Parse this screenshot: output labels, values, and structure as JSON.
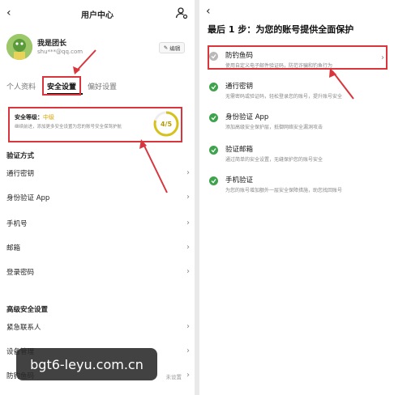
{
  "left": {
    "header": {
      "title": "用户中心"
    },
    "profile": {
      "name": "我是团长",
      "email": "shu***@qq.com",
      "edit_label": "编辑"
    },
    "tabs": [
      {
        "label": "个人资料"
      },
      {
        "label": "安全设置"
      },
      {
        "label": "偏好设置"
      }
    ],
    "security_card": {
      "title": "安全等级：",
      "level": "中级",
      "desc": "继续前进，添加更多安全设置为您的账号安全保驾护航",
      "score": "4/5"
    },
    "section_verify": "验证方式",
    "verify_items": [
      {
        "label": "通行密钥"
      },
      {
        "label": "身份验证 App"
      },
      {
        "label": "手机号"
      },
      {
        "label": "邮箱"
      },
      {
        "label": "登录密码"
      }
    ],
    "section_advanced": "高级安全设置",
    "advanced_items": [
      {
        "label": "紧急联系人",
        "extra": ""
      },
      {
        "label": "设备管理",
        "extra": ""
      },
      {
        "label": "防钓鱼码",
        "extra": "未设置"
      }
    ]
  },
  "watermark": "bgt6-leyu.com.cn",
  "right": {
    "title": "最后 1 步：为您的账号提供全面保护",
    "options": [
      {
        "title": "防钓鱼码",
        "desc": "使用自定义电子邮件验证码，防范诈骗和钓鱼行为",
        "done": false
      },
      {
        "title": "通行密钥",
        "desc": "无需密码或验证码，轻松登录您的账号，提升账号安全",
        "done": true
      },
      {
        "title": "身份验证 App",
        "desc": "添加高级安全保护层，抵御网络安全漏洞攻击",
        "done": true
      },
      {
        "title": "验证邮箱",
        "desc": "通过简单的安全设置，无缝保护您的账号安全",
        "done": true
      },
      {
        "title": "手机验证",
        "desc": "为您的账号增加额外一层安全保障措施，助您找回账号",
        "done": true
      }
    ]
  },
  "colors": {
    "highlight": "#d9353c",
    "check": "#3fa34d",
    "level": "#d6a400",
    "ring": "#d6c21a"
  }
}
